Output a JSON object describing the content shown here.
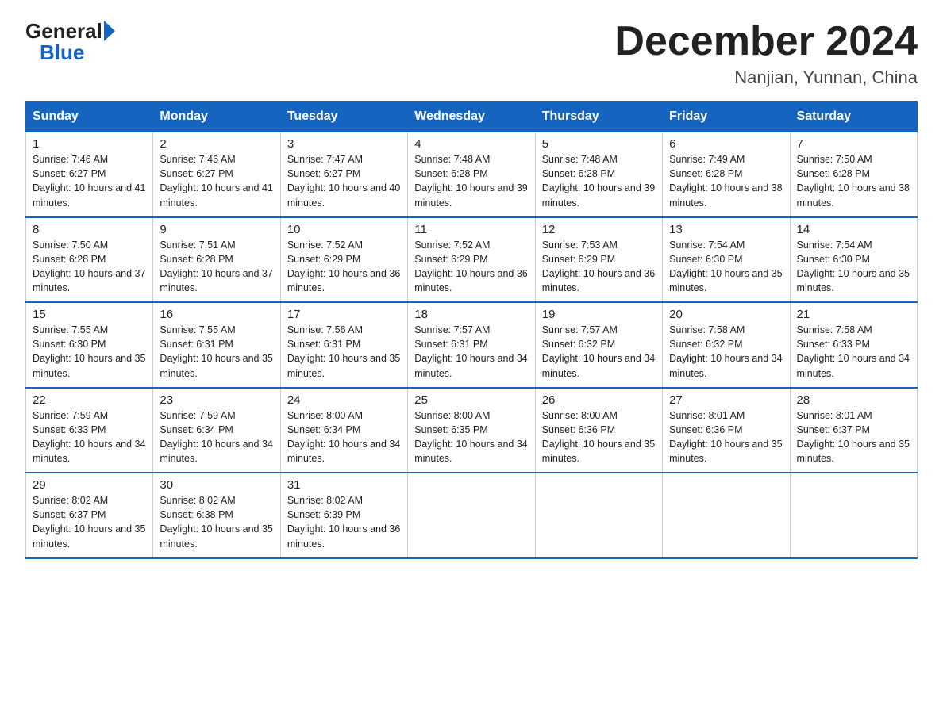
{
  "logo": {
    "general": "General",
    "blue": "Blue"
  },
  "title": "December 2024",
  "location": "Nanjian, Yunnan, China",
  "days_of_week": [
    "Sunday",
    "Monday",
    "Tuesday",
    "Wednesday",
    "Thursday",
    "Friday",
    "Saturday"
  ],
  "weeks": [
    [
      {
        "day": "1",
        "sunrise": "7:46 AM",
        "sunset": "6:27 PM",
        "daylight": "10 hours and 41 minutes."
      },
      {
        "day": "2",
        "sunrise": "7:46 AM",
        "sunset": "6:27 PM",
        "daylight": "10 hours and 41 minutes."
      },
      {
        "day": "3",
        "sunrise": "7:47 AM",
        "sunset": "6:27 PM",
        "daylight": "10 hours and 40 minutes."
      },
      {
        "day": "4",
        "sunrise": "7:48 AM",
        "sunset": "6:28 PM",
        "daylight": "10 hours and 39 minutes."
      },
      {
        "day": "5",
        "sunrise": "7:48 AM",
        "sunset": "6:28 PM",
        "daylight": "10 hours and 39 minutes."
      },
      {
        "day": "6",
        "sunrise": "7:49 AM",
        "sunset": "6:28 PM",
        "daylight": "10 hours and 38 minutes."
      },
      {
        "day": "7",
        "sunrise": "7:50 AM",
        "sunset": "6:28 PM",
        "daylight": "10 hours and 38 minutes."
      }
    ],
    [
      {
        "day": "8",
        "sunrise": "7:50 AM",
        "sunset": "6:28 PM",
        "daylight": "10 hours and 37 minutes."
      },
      {
        "day": "9",
        "sunrise": "7:51 AM",
        "sunset": "6:28 PM",
        "daylight": "10 hours and 37 minutes."
      },
      {
        "day": "10",
        "sunrise": "7:52 AM",
        "sunset": "6:29 PM",
        "daylight": "10 hours and 36 minutes."
      },
      {
        "day": "11",
        "sunrise": "7:52 AM",
        "sunset": "6:29 PM",
        "daylight": "10 hours and 36 minutes."
      },
      {
        "day": "12",
        "sunrise": "7:53 AM",
        "sunset": "6:29 PM",
        "daylight": "10 hours and 36 minutes."
      },
      {
        "day": "13",
        "sunrise": "7:54 AM",
        "sunset": "6:30 PM",
        "daylight": "10 hours and 35 minutes."
      },
      {
        "day": "14",
        "sunrise": "7:54 AM",
        "sunset": "6:30 PM",
        "daylight": "10 hours and 35 minutes."
      }
    ],
    [
      {
        "day": "15",
        "sunrise": "7:55 AM",
        "sunset": "6:30 PM",
        "daylight": "10 hours and 35 minutes."
      },
      {
        "day": "16",
        "sunrise": "7:55 AM",
        "sunset": "6:31 PM",
        "daylight": "10 hours and 35 minutes."
      },
      {
        "day": "17",
        "sunrise": "7:56 AM",
        "sunset": "6:31 PM",
        "daylight": "10 hours and 35 minutes."
      },
      {
        "day": "18",
        "sunrise": "7:57 AM",
        "sunset": "6:31 PM",
        "daylight": "10 hours and 34 minutes."
      },
      {
        "day": "19",
        "sunrise": "7:57 AM",
        "sunset": "6:32 PM",
        "daylight": "10 hours and 34 minutes."
      },
      {
        "day": "20",
        "sunrise": "7:58 AM",
        "sunset": "6:32 PM",
        "daylight": "10 hours and 34 minutes."
      },
      {
        "day": "21",
        "sunrise": "7:58 AM",
        "sunset": "6:33 PM",
        "daylight": "10 hours and 34 minutes."
      }
    ],
    [
      {
        "day": "22",
        "sunrise": "7:59 AM",
        "sunset": "6:33 PM",
        "daylight": "10 hours and 34 minutes."
      },
      {
        "day": "23",
        "sunrise": "7:59 AM",
        "sunset": "6:34 PM",
        "daylight": "10 hours and 34 minutes."
      },
      {
        "day": "24",
        "sunrise": "8:00 AM",
        "sunset": "6:34 PM",
        "daylight": "10 hours and 34 minutes."
      },
      {
        "day": "25",
        "sunrise": "8:00 AM",
        "sunset": "6:35 PM",
        "daylight": "10 hours and 34 minutes."
      },
      {
        "day": "26",
        "sunrise": "8:00 AM",
        "sunset": "6:36 PM",
        "daylight": "10 hours and 35 minutes."
      },
      {
        "day": "27",
        "sunrise": "8:01 AM",
        "sunset": "6:36 PM",
        "daylight": "10 hours and 35 minutes."
      },
      {
        "day": "28",
        "sunrise": "8:01 AM",
        "sunset": "6:37 PM",
        "daylight": "10 hours and 35 minutes."
      }
    ],
    [
      {
        "day": "29",
        "sunrise": "8:02 AM",
        "sunset": "6:37 PM",
        "daylight": "10 hours and 35 minutes."
      },
      {
        "day": "30",
        "sunrise": "8:02 AM",
        "sunset": "6:38 PM",
        "daylight": "10 hours and 35 minutes."
      },
      {
        "day": "31",
        "sunrise": "8:02 AM",
        "sunset": "6:39 PM",
        "daylight": "10 hours and 36 minutes."
      },
      null,
      null,
      null,
      null
    ]
  ]
}
